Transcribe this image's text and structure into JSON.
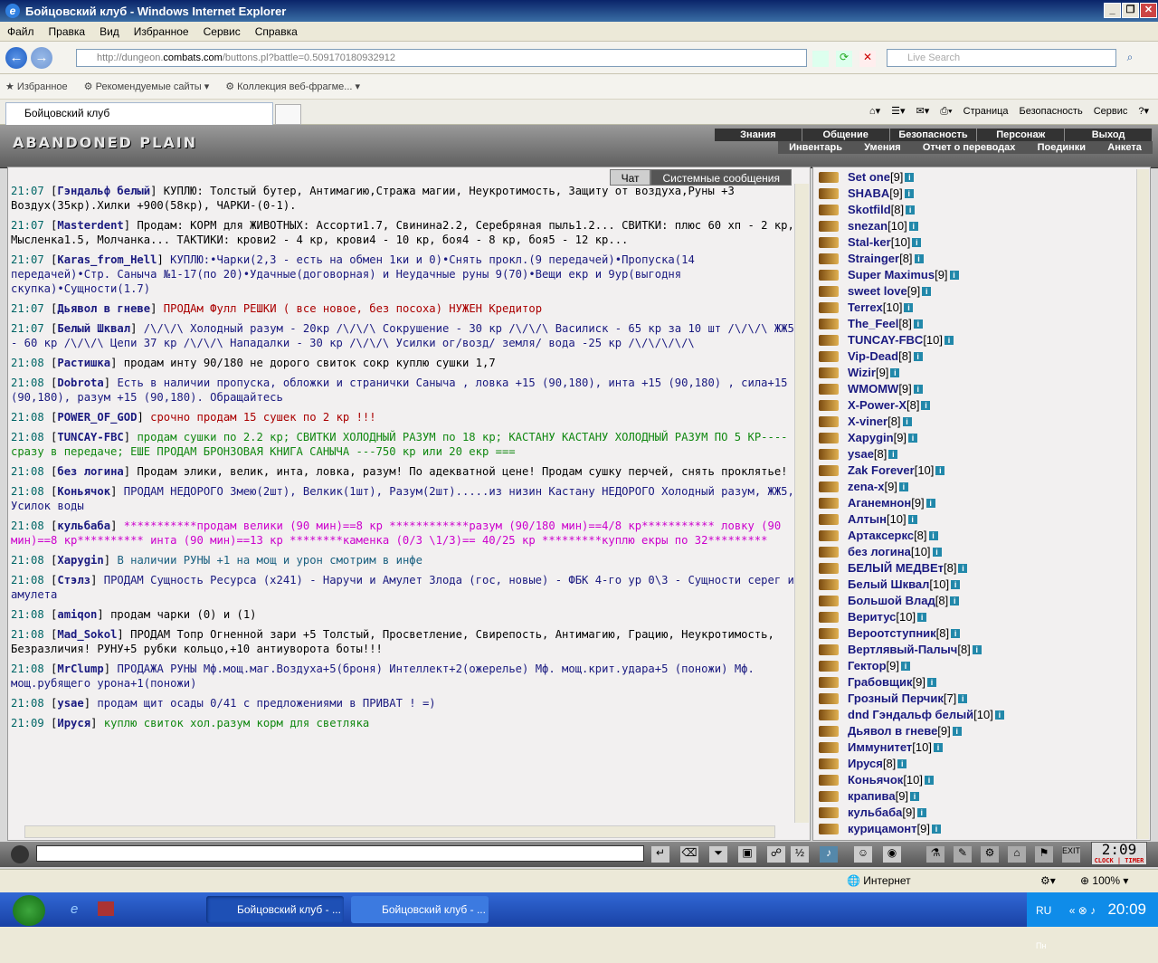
{
  "window": {
    "title": "Бойцовский клуб - Windows Internet Explorer"
  },
  "menu": [
    "Файл",
    "Правка",
    "Вид",
    "Избранное",
    "Сервис",
    "Справка"
  ],
  "address": {
    "url_prefix": "http://dungeon.",
    "url_domain": "combats.com",
    "url_suffix": "/buttons.pl?battle=0.509170180932912",
    "search_placeholder": "Live Search"
  },
  "favbar": {
    "favorites": "Избранное",
    "recommended": "Рекомендуемые сайты",
    "collection": "Коллекция веб-фрагме..."
  },
  "tabs": {
    "active": "Бойцовский клуб"
  },
  "cmdbar": [
    "Страница",
    "Безопасность",
    "Сервис"
  ],
  "game": {
    "logo": "ABANDONED PLAIN",
    "top_menu": [
      "Знания",
      "Общение",
      "Безопасность",
      "Персонаж",
      "Выход"
    ],
    "sub_menu": [
      "Инвентарь",
      "Умения",
      "Отчет о переводах",
      "Поединки",
      "Анкета"
    ],
    "chat_tabs": {
      "chat": "Чат",
      "system": "Системные сообщения"
    },
    "clock": "2:09",
    "clock_label": "CLOCK | TIMER"
  },
  "chat": [
    {
      "time": "21:07",
      "name": "Гэндальф белый",
      "text": "КУПЛЮ: Толстый бутер, Антимагию,Стража магии, Неукротимость, Защиту от воздуха,Руны +3 Воздух(35кр).Хилки +900(58кр), ЧАРКИ-(0-1).",
      "color": "#000000"
    },
    {
      "time": "21:07",
      "name": "Masterdent",
      "text": "Продам: КОРМ для ЖИВОТНЫХ: Ассорти1.7, Свинина2.2, Серебряная пыль1.2... СВИТКИ: плюс 60 хп - 2 кр, Мысленка1.5, Молчанка... ТАКТИКИ: крови2 - 4 кр, крови4 - 10 кр, боя4 - 8 кр, боя5 - 12 кр...",
      "color": "#000000"
    },
    {
      "time": "21:07",
      "name": "Karas_from_Hell",
      "text": "КУПЛЮ:•Чарки(2,3 - есть на обмен 1ки и 0)•Снять прокл.(9 передачей)•Пропуска(14 передачей)•Стр. Саныча №1-17(по 20)•Удачные(договорная) и Неудачные руны 9(70)•Вещи екр и 9ур(выгодня скупка)•Сущности(1.7)",
      "color": "#1a1a80"
    },
    {
      "time": "21:07",
      "name": "Дьявол в гневе",
      "text": "ПРОДАм  Фулл РЕШКИ ( все новое, без посоха)  НУЖЕН Кредитор",
      "color": "#aa0000"
    },
    {
      "time": "21:07",
      "name": "Белый Шквал",
      "text": "/\\/\\/\\ Холодный разум - 20кр /\\/\\/\\ Сокрушение - 30 кр /\\/\\/\\ Василиск - 65 кр за 10 шт /\\/\\/\\ ЖЖ5 - 60 кр /\\/\\/\\ Цепи 37 кр /\\/\\/\\ Нападалки - 30 кр /\\/\\/\\ Усилки ог/возд/ земля/ вода -25 кр /\\/\\/\\/\\/\\",
      "color": "#1a1a80"
    },
    {
      "time": "21:08",
      "name": "Растишка",
      "text": "продам инту 90/180 не дорого свиток сокр куплю сушки 1,7",
      "color": "#000000"
    },
    {
      "time": "21:08",
      "name": "Dobrota",
      "text": "Есть в наличии пропуска, обложки и странички Саныча , ловка +15 (90,180), инта +15 (90,180) , сила+15 (90,180), разум +15 (90,180). Обращайтесь",
      "color": "#1a1a80"
    },
    {
      "time": "21:08",
      "name": "POWER_OF_GOD",
      "text": "срочно продам 15 сушек по 2 кр !!!",
      "color": "#aa0000"
    },
    {
      "time": "21:08",
      "name": "TUNCAY-FBC",
      "text": "продам сушки по 2.2 кр; СВИТКИ ХОЛОДНЫЙ РАЗУМ по 18 кр; КАСТАНУ КАСТАНУ ХОЛОДНЫЙ РАЗУМ ПО 5 КР---- сразу в передаче; ЕШЕ ПРОДАМ БРОНЗОВАЯ КНИГА САНЫЧА ---750 кр или 20 екр ===",
      "color": "#118811"
    },
    {
      "time": "21:08",
      "name": "без логина",
      "text": "Продам элики, велик, инта, ловка, разум! По адекватной цене! Продам сушку перчей, снять проклятье!",
      "color": "#000000"
    },
    {
      "time": "21:08",
      "name": "Коньячок",
      "text": "ПРОДАМ НЕДОРОГО Змею(2шт), Велкик(1шт), Разум(2шт).....из низин  Кастану НЕДОРОГО Холодный разум, ЖЖ5, Усилок воды",
      "color": "#1a1a80"
    },
    {
      "time": "21:08",
      "name": "кульбаба",
      "text": "***********продам велики (90 мин)==8 кр ************разум (90/180 мин)==4/8 кр*********** ловку (90 мин)==8 кр********** инта (90 мин)==13 кр ********каменка (0/3 \\1/3)== 40/25 кр *********куплю екры по 32*********",
      "color": "#cc00cc"
    },
    {
      "time": "21:08",
      "name": "Хаpygin",
      "text": "В наличии РУНЫ +1 на мощ и урон смотрим в инфе",
      "color": "#1a6080"
    },
    {
      "time": "21:08",
      "name": "Стэлз",
      "text": "ПРОДАМ Сущность Ресурса (х241) - Наручи и Амулет Злода (гос, новые) - ФБК 4-го ур 0\\3 - Сущности серег и амулета",
      "color": "#1a1a80"
    },
    {
      "time": "21:08",
      "name": "amiqon",
      "text": "продам чарки (0) и (1)",
      "color": "#000000"
    },
    {
      "time": "21:08",
      "name": "Mad_Sokol",
      "text": "ПРОДАМ Топр Огненной зари +5 Толстый, Просветление, Свирепость, Антимагию, Грацию, Неукротимость, Безразличия! РУНУ+5 рубки кольцо,+10 антиуворота боты!!!",
      "color": "#000000"
    },
    {
      "time": "21:08",
      "name": "MrClump",
      "text": "ПРОДАЖА  РУНЫ Мф.мощ.маг.Воздуха+5(броня) Интеллект+2(ожерелье) Мф. мощ.крит.удара+5 (поножи) Мф. мощ.рубящего урона+1(поножи)",
      "color": "#1a1a80"
    },
    {
      "time": "21:08",
      "name": "ysae",
      "text": "продам щит осады 0/41 с предложениями в ПРИВАТ ! =)",
      "color": "#1a1a80"
    },
    {
      "time": "21:09",
      "name": "Ируся",
      "text": "куплю свиток хол.разум корм для светляка",
      "color": "#118811"
    }
  ],
  "users": [
    {
      "name": "Set one",
      "level": "[9]"
    },
    {
      "name": "SHABA",
      "level": "[9]"
    },
    {
      "name": "Skotfild",
      "level": "[8]"
    },
    {
      "name": "snezan",
      "level": "[10]"
    },
    {
      "name": "Stal-ker",
      "level": "[10]"
    },
    {
      "name": "Strainger",
      "level": "[8]"
    },
    {
      "name": "Super Maximus",
      "level": "[9]"
    },
    {
      "name": "sweet love",
      "level": "[9]"
    },
    {
      "name": "Terrex",
      "level": "[10]"
    },
    {
      "name": "The_Feel",
      "level": "[8]"
    },
    {
      "name": "TUNCAY-FBC",
      "level": "[10]"
    },
    {
      "name": "Vip-Dead",
      "level": "[8]"
    },
    {
      "name": "Wizir",
      "level": "[9]"
    },
    {
      "name": "WMOMW",
      "level": "[9]"
    },
    {
      "name": "X-Power-X",
      "level": "[8]"
    },
    {
      "name": "X-viner",
      "level": "[8]"
    },
    {
      "name": "Xapygin",
      "level": "[9]"
    },
    {
      "name": "ysae",
      "level": "[8]"
    },
    {
      "name": "Zak Forever",
      "level": "[10]"
    },
    {
      "name": "zena-x",
      "level": "[9]"
    },
    {
      "name": "Аганемнон",
      "level": "[9]"
    },
    {
      "name": "Алтын",
      "level": "[10]"
    },
    {
      "name": "Артаксеркс",
      "level": "[8]"
    },
    {
      "name": "без логина",
      "level": "[10]"
    },
    {
      "name": "БЕЛЫЙ МЕДВЕт",
      "level": "[8]"
    },
    {
      "name": "Белый Шквал",
      "level": "[10]"
    },
    {
      "name": "Большой Влад",
      "level": "[8]"
    },
    {
      "name": "Веритус",
      "level": "[10]"
    },
    {
      "name": "Вероотступник",
      "level": "[8]"
    },
    {
      "name": "Вертлявый-Палыч",
      "level": "[8]"
    },
    {
      "name": "Гектор",
      "level": "[9]"
    },
    {
      "name": "Грабовщик",
      "level": "[9]"
    },
    {
      "name": "Грозный Перчик",
      "level": "[7]"
    },
    {
      "name": "dnd Гэндальф белый",
      "level": "[10]"
    },
    {
      "name": "Дьявол в гневе",
      "level": "[9]"
    },
    {
      "name": "Иммунитет",
      "level": "[10]"
    },
    {
      "name": "Ируся",
      "level": "[8]"
    },
    {
      "name": "Коньячок",
      "level": "[10]"
    },
    {
      "name": "крапива",
      "level": "[9]"
    },
    {
      "name": "кульбаба",
      "level": "[9]"
    },
    {
      "name": "курицамонт",
      "level": "[9]"
    }
  ],
  "status": {
    "zone": "Интернет",
    "zoom": "100%"
  },
  "taskbar": {
    "task1": "Бойцовский клуб - ...",
    "task2": "Бойцовский клуб - ...",
    "lang": "RU",
    "time": "20:09",
    "day": "Пн"
  }
}
